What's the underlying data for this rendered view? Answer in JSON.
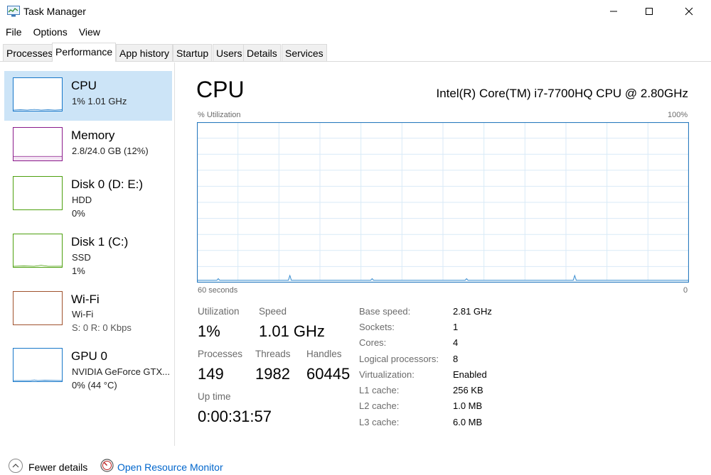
{
  "window": {
    "title": "Task Manager",
    "icon": "task-manager-icon"
  },
  "menu": [
    "File",
    "Options",
    "View"
  ],
  "tabs": [
    "Processes",
    "Performance",
    "App history",
    "Startup",
    "Users",
    "Details",
    "Services"
  ],
  "active_tab": "Performance",
  "sidebar": {
    "items": [
      {
        "name": "CPU",
        "line1": "1%  1.01 GHz",
        "line2": "",
        "color": "#1777c9"
      },
      {
        "name": "Memory",
        "line1": "2.8/24.0 GB (12%)",
        "line2": "",
        "color": "#8b1a8b"
      },
      {
        "name": "Disk 0 (D: E:)",
        "line1": "HDD",
        "line2": "0%",
        "color": "#4da00e"
      },
      {
        "name": "Disk 1 (C:)",
        "line1": "SSD",
        "line2": "1%",
        "color": "#4da00e"
      },
      {
        "name": "Wi-Fi",
        "line1": "Wi-Fi",
        "line2": "S: 0 R: 0 Kbps",
        "color": "#a0522d"
      },
      {
        "name": "GPU 0",
        "line1": "NVIDIA GeForce GTX...",
        "line2": "0%  (44 °C)",
        "color": "#1777c9"
      }
    ]
  },
  "main": {
    "title": "CPU",
    "model": "Intel(R) Core(TM) i7-7700HQ CPU @ 2.80GHz",
    "graph": {
      "y_label": "% Utilization",
      "y_max_label": "100%",
      "x_label": "60 seconds",
      "x_min_label": "0",
      "line_color": "#3d8fd1",
      "grid_color": "#d9eaf7",
      "utilization_series": [
        1,
        1,
        1,
        1,
        1,
        1,
        1,
        1,
        1,
        1,
        1,
        1,
        1,
        1,
        2,
        1,
        1,
        1,
        1,
        1,
        1,
        1,
        1,
        1,
        1,
        1,
        1,
        1,
        1,
        1,
        1,
        1,
        1,
        1,
        1,
        1,
        1,
        1,
        1,
        1,
        1,
        1,
        1,
        1,
        1,
        1,
        1,
        1,
        1,
        1,
        1,
        1,
        1,
        1,
        1,
        1,
        1,
        1,
        1,
        1,
        1,
        4,
        1,
        1,
        1,
        1,
        1,
        1,
        1,
        1,
        1,
        1,
        1,
        1,
        1,
        1,
        1,
        1,
        1,
        1,
        1,
        1,
        1,
        1,
        1,
        1,
        1,
        1,
        1,
        1,
        1,
        1,
        1,
        1,
        1,
        1,
        1,
        1,
        1,
        1,
        1,
        1,
        1,
        1,
        1,
        1,
        1,
        1,
        1,
        1,
        1,
        1,
        1,
        1,
        1,
        2,
        1,
        1,
        1,
        1,
        1,
        1,
        1,
        1,
        1,
        1,
        1,
        1,
        1,
        1,
        1,
        1,
        1,
        1,
        1,
        1,
        1,
        1,
        1,
        1,
        1,
        1,
        1,
        1,
        1,
        1,
        1,
        1,
        1,
        1,
        1,
        1,
        1,
        1,
        1,
        1,
        1,
        1,
        1,
        1,
        1,
        1,
        1,
        1,
        1,
        1,
        1,
        1,
        1,
        1,
        1,
        1,
        1,
        1,
        1,
        1,
        1,
        2,
        1,
        1,
        1,
        1,
        1,
        1,
        1,
        1,
        1,
        1,
        1,
        1,
        1,
        1,
        1,
        1,
        1,
        1,
        1,
        1,
        1,
        1,
        1,
        1,
        1,
        1,
        1,
        1,
        1,
        1,
        1,
        1,
        1,
        1,
        1,
        1,
        1,
        1,
        1,
        1,
        1,
        1,
        1,
        1,
        1,
        1,
        1,
        1,
        1,
        1,
        1,
        1,
        1,
        1,
        1,
        1,
        1,
        1,
        1,
        1,
        1,
        1,
        1,
        1,
        1,
        1,
        1,
        1,
        1,
        1,
        4,
        1,
        1,
        1,
        1,
        1,
        1,
        1,
        1,
        1,
        1,
        1,
        1,
        1,
        1,
        1,
        1,
        1,
        1,
        1,
        1,
        1,
        1,
        1,
        1,
        1,
        1,
        1,
        1,
        1,
        1,
        1,
        1,
        1,
        1,
        1,
        1,
        1,
        1,
        1,
        1,
        1,
        1,
        1,
        1,
        1,
        1,
        1,
        1,
        1,
        1,
        1,
        1,
        1,
        1,
        1,
        1,
        1,
        1,
        1,
        1,
        1,
        1,
        1,
        1,
        1,
        1,
        1,
        1,
        1,
        1,
        1,
        1,
        1,
        1,
        1
      ]
    },
    "stats": {
      "utilization_label": "Utilization",
      "utilization": "1%",
      "speed_label": "Speed",
      "speed": "1.01 GHz",
      "processes_label": "Processes",
      "processes": "149",
      "threads_label": "Threads",
      "threads": "1982",
      "handles_label": "Handles",
      "handles": "60445",
      "uptime_label": "Up time",
      "uptime": "0:00:31:57"
    },
    "specs": [
      {
        "label": "Base speed:",
        "value": "2.81 GHz"
      },
      {
        "label": "Sockets:",
        "value": "1"
      },
      {
        "label": "Cores:",
        "value": "4"
      },
      {
        "label": "Logical processors:",
        "value": "8"
      },
      {
        "label": "Virtualization:",
        "value": "Enabled"
      },
      {
        "label": "L1 cache:",
        "value": "256 KB"
      },
      {
        "label": "L2 cache:",
        "value": "1.0 MB"
      },
      {
        "label": "L3 cache:",
        "value": "6.0 MB"
      }
    ]
  },
  "footer": {
    "fewer_details": "Fewer details",
    "open_resource_monitor": "Open Resource Monitor"
  }
}
